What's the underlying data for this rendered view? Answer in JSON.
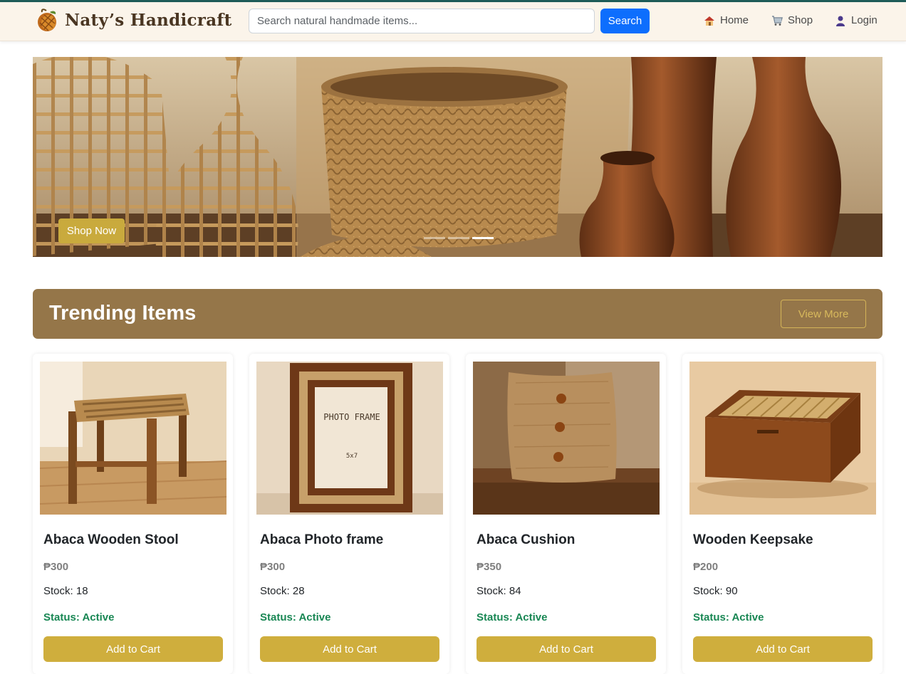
{
  "brand": {
    "name": "Naty’s Handicraft",
    "logo_icon": "pinecone-logo-icon"
  },
  "search": {
    "placeholder": "Search natural handmade items...",
    "button_label": "Search"
  },
  "nav": [
    {
      "label": "Home",
      "icon": "house-icon"
    },
    {
      "label": "Shop",
      "icon": "cart-icon"
    },
    {
      "label": "Login",
      "icon": "user-icon"
    }
  ],
  "hero": {
    "button_label": "Shop Now",
    "slides": 3,
    "active_slide": 3
  },
  "trending": {
    "title": "Trending Items",
    "view_more_label": "View More"
  },
  "products": [
    {
      "name": "Abaca Wooden Stool",
      "price": "₱300",
      "stock": "Stock: 18",
      "status": "Status: Active",
      "button_label": "Add to Cart",
      "image": "stool-image"
    },
    {
      "name": "Abaca Photo frame",
      "price": "₱300",
      "stock": "Stock: 28",
      "status": "Status: Active",
      "button_label": "Add to Cart",
      "image": "photo-frame-image"
    },
    {
      "name": "Abaca Cushion",
      "price": "₱350",
      "stock": "Stock: 84",
      "status": "Status: Active",
      "button_label": "Add to Cart",
      "image": "cushion-image"
    },
    {
      "name": "Wooden Keepsake",
      "price": "₱200",
      "stock": "Stock: 90",
      "status": "Status: Active",
      "button_label": "Add to Cart",
      "image": "keepsake-box-image"
    }
  ],
  "frame_label": {
    "title": "PHOTO FRAME",
    "size": "5x7"
  },
  "colors": {
    "accent_gold": "#cfae3d",
    "trend_bar": "#957649",
    "status_green": "#198754",
    "search_blue": "#0d6efd"
  }
}
